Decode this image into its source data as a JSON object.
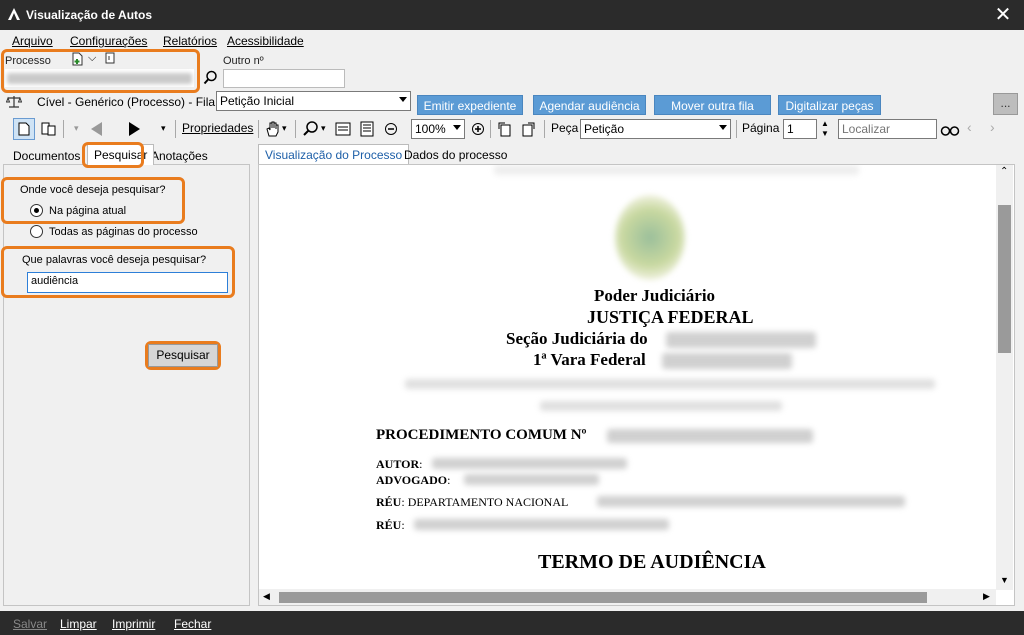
{
  "window": {
    "title": "Visualização de Autos"
  },
  "menu": [
    "Arquivo",
    "Configurações",
    "Relatórios",
    "Acessibilidade"
  ],
  "processo": {
    "label": "Processo",
    "outro_label": "Outro nº"
  },
  "fila": {
    "classe": "Cível - Genérico (Processo) - Fila:",
    "selected": "Petição Inicial",
    "buttons": [
      "Emitir expediente",
      "Agendar audiência",
      "Mover outra fila",
      "Digitalizar peças"
    ],
    "more": "..."
  },
  "toolbar": {
    "propriedades": "Propriedades",
    "zoom": "100%",
    "peca_label": "Peça",
    "peca_value": "Petição",
    "pagina_label": "Página",
    "pagina_value": "1",
    "search_placeholder": "Localizar"
  },
  "left_tabs": [
    "Documentos",
    "Pesquisar",
    "Anotações"
  ],
  "search": {
    "where_label": "Onde você deseja pesquisar?",
    "opt_current": "Na página atual",
    "opt_all": "Todas as páginas do processo",
    "words_label": "Que palavras você deseja pesquisar?",
    "query": "audiência",
    "button": "Pesquisar"
  },
  "doc_tabs": [
    "Visualização do Processo",
    "Dados do processo"
  ],
  "document": {
    "line1": "Poder Judiciário",
    "line2": "JUSTIÇA FEDERAL",
    "line3": "Seção Judiciária do",
    "line4": "1ª Vara Federal",
    "procedimento": "PROCEDIMENTO COMUM Nº",
    "autor": "AUTOR",
    "advogado": "ADVOGADO",
    "reu1": "RÉU",
    "reu1_value": "DEPARTAMENTO NACIONAL",
    "reu2": "RÉU",
    "termo": "TERMO DE AUDIÊNCIA"
  },
  "status": {
    "salvar": "Salvar",
    "limpar": "Limpar",
    "imprimir": "Imprimir",
    "fechar": "Fechar"
  },
  "colors": {
    "accent": "#e97c1e",
    "button_blue": "#5b9bd5",
    "titlebar": "#2b2b2b"
  }
}
